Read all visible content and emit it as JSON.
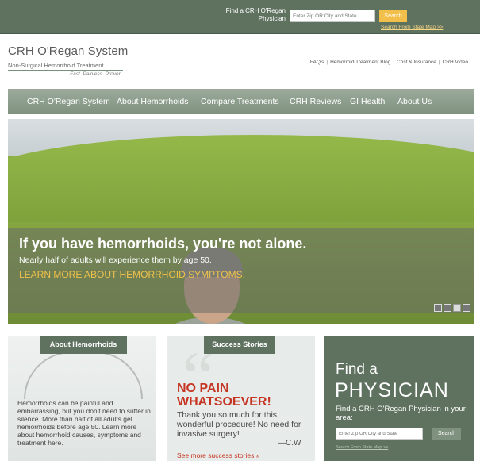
{
  "topbar": {
    "find_label": "Find a CRH O'Regan Physician",
    "search_placeholder": "Enter Zip OR City and State",
    "search_button": "Search",
    "state_map_link": "Search From State Map >>"
  },
  "logo": {
    "name": "CRH O'Regan System",
    "subtitle": "Non-Surgical Hemorrhoid Treatment",
    "tagline": "Fast. Painless. Proven."
  },
  "utility_links": [
    "FAQ's",
    "Hemorroid Treatment Blog",
    "Cost & Insurance",
    "CRH Video"
  ],
  "nav": [
    "CRH O'Regan System",
    "About Hemorrhoids",
    "Compare Treatments",
    "CRH Reviews",
    "GI Health",
    "About Us"
  ],
  "hero": {
    "title": "If you have hemorrhoids, you're not alone.",
    "subtitle": "Nearly half of adults will experience them by age 50.",
    "link": "LEARN MORE ABOUT HEMORRHOID SYMPTOMS."
  },
  "panel_about": {
    "heading": "About Hemorrhoids",
    "text": "Hemorrhoids can be painful and embarrassing, but you don't need to suffer in silence. More than half of all adults get hemorrhoids before age 50. Learn more about hemorrhoid causes, symptoms and treatment here."
  },
  "panel_success": {
    "heading": "Success Stories",
    "title_line1": "NO PAIN",
    "title_line2": "WHATSOEVER!",
    "quote": "Thank you so much for this wonderful procedure! No need for invasive surgery!",
    "signature": "—C.W",
    "more_link": "See more success stories »"
  },
  "panel_find": {
    "find": "Find a",
    "physician": "PHYSICIAN",
    "sub": "Find a CRH O'Regan Physician in your area:",
    "search_placeholder": "Enter Zip OR City and State",
    "search_button": "Search",
    "state_map_link": "Search From State Map >>"
  },
  "colors": {
    "brand_green": "#5f7260",
    "accent_yellow": "#f2c04a",
    "accent_red": "#c63523"
  }
}
